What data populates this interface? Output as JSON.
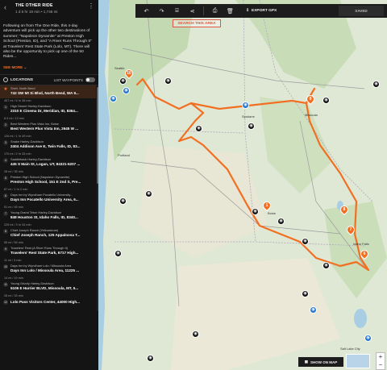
{
  "ride": {
    "title": "THE OTHER RIDE",
    "meta": "1 d 6 hr 19 min • 1,746 mi",
    "description": "Following on from The One Ride, this 4-day adventure will pick up the other two destinations of summer; \"Napoleon Dynamite\" at Preston High School (Preston, ID), and \"A River Runs Through It\" at Travelers' Rest State Park (Lolo, MT). There will also be the opportunity to pick up one of the 50 Rides...",
    "see_more": "SEE MORE"
  },
  "locations": {
    "label": "LOCATIONS",
    "waypoints_label": "LIST WAYPOINTS"
  },
  "stops": [
    {
      "badge": "",
      "name": "Shell, North Bend",
      "addr": "742 SW Mt Si Blvd, North Bend, WA 9...",
      "leg": "457 mi / 6 hr 38 min"
    },
    {
      "badge": "1",
      "name": "High Desert Harley-Davidson",
      "addr": "2310 E Cinema Dr, Meridian, ID, 8364...",
      "leg": "8.9 mi / 13 min"
    },
    {
      "badge": "2",
      "name": "Best Western Plus Vista Inn, Boise",
      "addr": "Best Western Plus Vista Inn, 2645 W ...",
      "leg": "126 mi / 1 hr 49 min"
    },
    {
      "badge": "3",
      "name": "Snake Harley-Davidson",
      "addr": "2404 Addison Ave E, Twin Falls, ID, 83...",
      "leg": "170 mi / 2 hr 28 min"
    },
    {
      "badge": "4",
      "name": "Saddleback Harley-Davidson",
      "addr": "445 S Main St, Logan, UT, 84321-5207 ...",
      "leg": "28 mi / 35 min"
    },
    {
      "badge": "5",
      "name": "Preston High School (Napoleon Dynamite)",
      "addr": "Preston High School, 151 E 2nd S, Pre...",
      "leg": "87 mi / 1 hr 2 min"
    },
    {
      "badge": "6",
      "name": "Days Inn by Wyndham Pocatello University...",
      "addr": "Days Inn Pocatello University Area, 6...",
      "leg": "51 mi / 45 min"
    },
    {
      "badge": "7",
      "name": "Young Grand Teton Harley-Davidson",
      "addr": "848 Houston St, Idaho Falls, ID, 8340...",
      "leg": "225 mi / 3 hr 34 min"
    },
    {
      "badge": "8",
      "name": "Chief Joseph Ranch (Yellowstone)",
      "addr": "Chief Joseph Ranch, 125 Appaloosa T...",
      "leg": "55 mi / 59 min"
    },
    {
      "badge": "9",
      "name": "Travelers' Rest (A River Runs Through It)",
      "addr": "Travelers' Rest State Park, 6717 High...",
      "leg": "11 mi / 3 min"
    },
    {
      "badge": "10",
      "name": "Days Inn by Wyndham Lolo / Missoula Area",
      "addr": "Days Inn Lolo / Missoula Area, 11225 ...",
      "leg": "14 mi / 19 min"
    },
    {
      "badge": "11",
      "name": "Young Grizzly Harley-Davidson",
      "addr": "5106 E Harrier BLVD, Missoula, MT, 5...",
      "leg": "28 mi / 33 min"
    },
    {
      "badge": "12",
      "name": "",
      "addr": "Lolo Pass Visitors Center, 44000 High...",
      "leg": ""
    }
  ],
  "toolbar": {
    "export_label": "EXPORT GPX",
    "saved_label": "SAVED"
  },
  "map": {
    "search_area": "SEARCH THIS AREA",
    "show_on_map": "SHOW ON MAP",
    "pins": [
      "10",
      "9",
      "8",
      "7",
      "6",
      "1"
    ],
    "cities": [
      "Seattle",
      "Spokane",
      "Missoula",
      "Portland",
      "Boise",
      "Idaho Falls",
      "Salt Lake City"
    ]
  },
  "colors": {
    "route": "#f26f21",
    "accent": "#f26f21",
    "sidebar_bg": "#141414"
  }
}
